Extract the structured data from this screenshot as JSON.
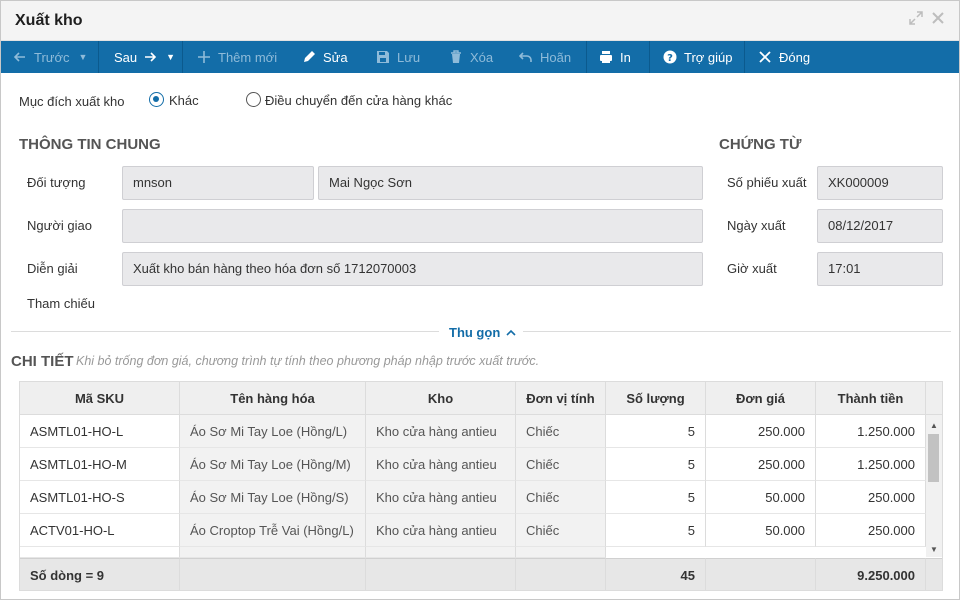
{
  "window": {
    "title": "Xuất kho"
  },
  "toolbar": {
    "prev": "Trước",
    "next": "Sau",
    "add": "Thêm mới",
    "edit": "Sửa",
    "save": "Lưu",
    "delete": "Xóa",
    "undo": "Hoãn",
    "print": "In",
    "help": "Trợ giúp",
    "close": "Đóng"
  },
  "purpose": {
    "label": "Mục đích xuất kho",
    "options": [
      "Khác",
      "Điều chuyển đến cửa hàng khác"
    ],
    "selected": "Khác"
  },
  "general": {
    "heading": "THÔNG TIN CHUNG",
    "object_label": "Đối tượng",
    "object_code": "mnson",
    "object_name": "Mai Ngọc Sơn",
    "deliverer_label": "Người giao",
    "deliverer": "",
    "desc_label": "Diễn giải",
    "desc": "Xuất kho bán hàng theo hóa đơn số 1712070003",
    "ref_label": "Tham chiếu"
  },
  "voucher": {
    "heading": "CHỨNG TỪ",
    "number_label": "Số phiếu xuất",
    "number": "XK000009",
    "date_label": "Ngày xuất",
    "date": "08/12/2017",
    "time_label": "Giờ xuất",
    "time": "17:01"
  },
  "collapse_label": "Thu gọn",
  "detail": {
    "heading": "CHI TIẾT",
    "hint": "Khi bỏ trống đơn giá, chương trình tự tính theo phương pháp nhập trước xuất trước.",
    "columns": [
      "Mã SKU",
      "Tên hàng hóa",
      "Kho",
      "Đơn vị tính",
      "Số lượng",
      "Đơn giá",
      "Thành tiền"
    ],
    "rows": [
      [
        "ASMTL01-HO-L",
        "Áo Sơ Mi Tay Loe (Hồng/L)",
        "Kho cửa hàng antieu",
        "Chiếc",
        "5",
        "250.000",
        "1.250.000"
      ],
      [
        "ASMTL01-HO-M",
        "Áo Sơ Mi Tay Loe (Hồng/M)",
        "Kho cửa hàng antieu",
        "Chiếc",
        "5",
        "250.000",
        "1.250.000"
      ],
      [
        "ASMTL01-HO-S",
        "Áo Sơ Mi Tay Loe (Hồng/S)",
        "Kho cửa hàng antieu",
        "Chiếc",
        "5",
        "50.000",
        "250.000"
      ],
      [
        "ACTV01-HO-L",
        "Áo Croptop Trễ Vai (Hồng/L)",
        "Kho cửa hàng antieu",
        "Chiếc",
        "5",
        "50.000",
        "250.000"
      ]
    ],
    "footer": {
      "row_count": "Số dòng = 9",
      "total_qty": "45",
      "total_amount": "9.250.000"
    }
  }
}
